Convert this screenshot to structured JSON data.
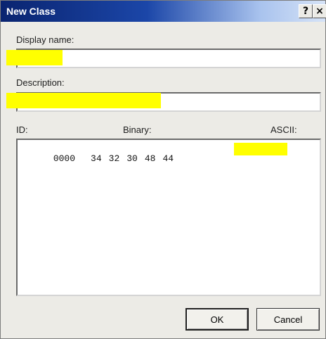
{
  "window": {
    "title": "New Class",
    "help_label": "?",
    "close_label": "×"
  },
  "display_name": {
    "label": "Display name:",
    "value": ""
  },
  "description": {
    "label": "Description:",
    "value": ""
  },
  "data_editor": {
    "id_label": "ID:",
    "binary_label": "Binary:",
    "ascii_label": "ASCII:",
    "row": {
      "address": "0000",
      "bytes": [
        "34",
        "32",
        "30",
        "48",
        "44"
      ]
    }
  },
  "buttons": {
    "ok": "OK",
    "cancel": "Cancel"
  },
  "colors": {
    "title_bar_start": "#0a2470",
    "highlight": "#ffff00",
    "dialog_bg": "#ecebe6"
  }
}
